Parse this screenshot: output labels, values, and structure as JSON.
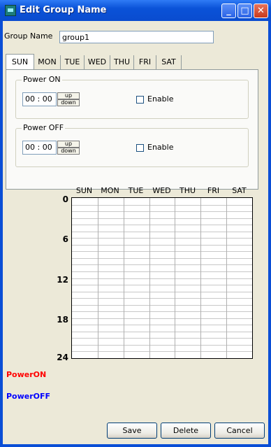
{
  "window": {
    "title": "Edit Group Name",
    "minimize_glyph": "_",
    "maximize_glyph": "□",
    "close_glyph": "✕"
  },
  "group_name": {
    "label": "Group Name",
    "value": "group1"
  },
  "tabs": [
    "SUN",
    "MON",
    "TUE",
    "WED",
    "THU",
    "FRI",
    "SAT"
  ],
  "active_tab": "SUN",
  "power_on": {
    "title": "Power ON",
    "time": "00 : 00",
    "up": "up",
    "down": "down",
    "enable_label": "Enable",
    "enabled": false
  },
  "power_off": {
    "title": "Power OFF",
    "time": "00 : 00",
    "up": "up",
    "down": "down",
    "enable_label": "Enable",
    "enabled": false
  },
  "schedule": {
    "days": [
      "SUN",
      "MON",
      "TUE",
      "WED",
      "THU",
      "FRI",
      "SAT"
    ],
    "hour_labels": [
      "0",
      "6",
      "12",
      "18",
      "24"
    ],
    "hours": 24
  },
  "legend": {
    "power_on": "PowerON",
    "power_off": "PowerOFF",
    "power_on_color": "#ff0000",
    "power_off_color": "#0000ff"
  },
  "buttons": {
    "save": "Save",
    "delete": "Delete",
    "cancel": "Cancel"
  }
}
